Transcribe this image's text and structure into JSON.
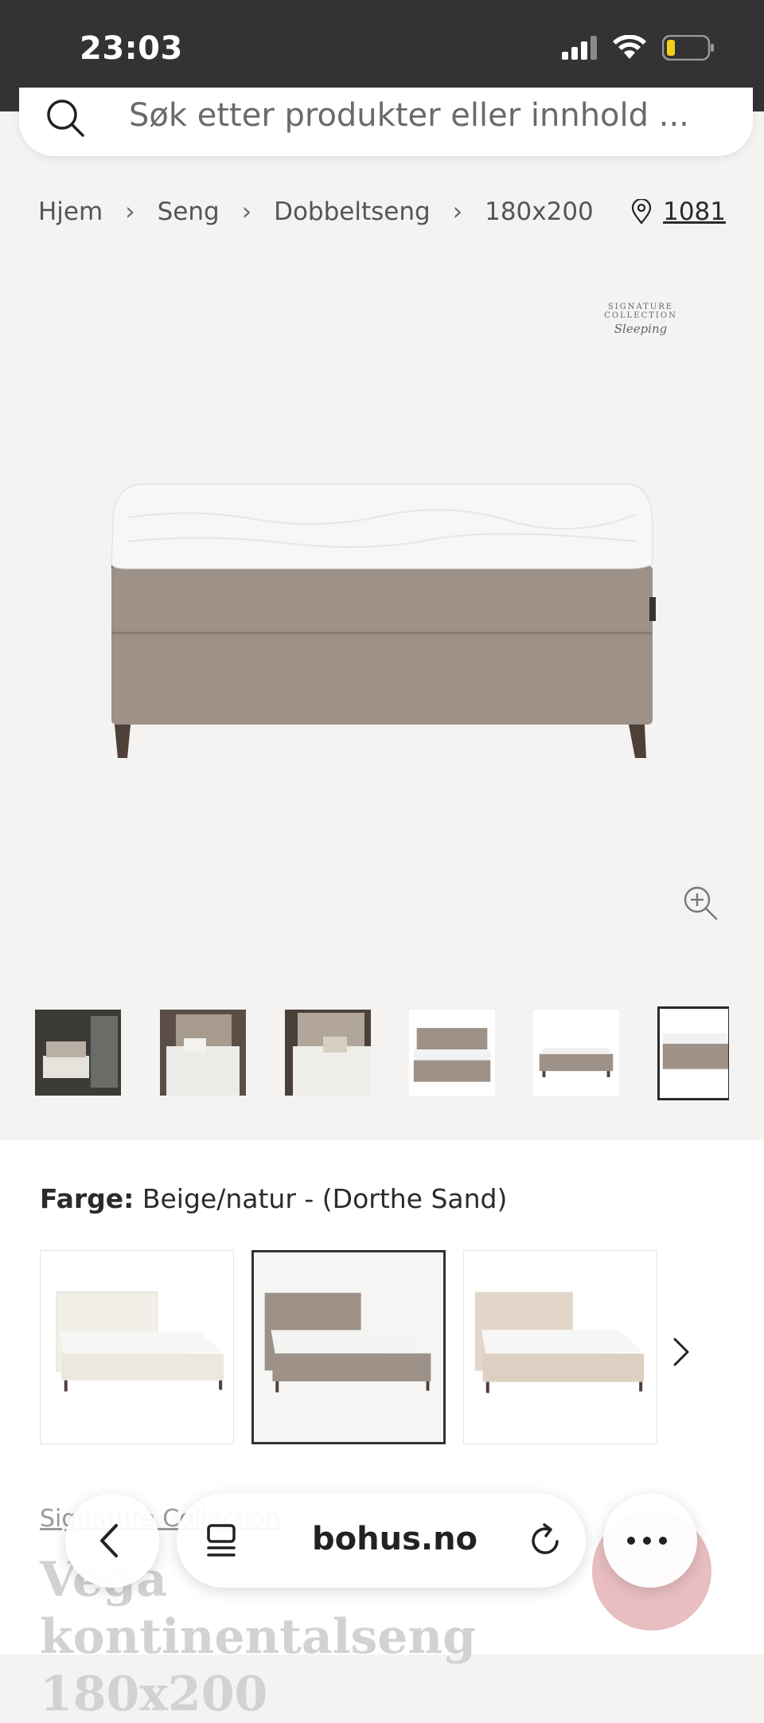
{
  "status": {
    "time": "23:03"
  },
  "search": {
    "placeholder": "Søk etter produkter eller innhold ..."
  },
  "breadcrumb": [
    "Hjem",
    "Seng",
    "Dobbeltseng",
    "180x200"
  ],
  "location": {
    "code": "1081"
  },
  "brand": {
    "line1": "SIGNATURE COLLECTION",
    "line2": "Sleeping"
  },
  "colors": {
    "accent_dark": "#333336",
    "bed_fabric": "#9b8f86",
    "mattress": "#f4f4f4",
    "fab": "#e6b7ba"
  },
  "color_picker": {
    "label": "Farge:",
    "value": "Beige/natur - (Dorthe Sand)"
  },
  "product": {
    "collection": "Signature Collection",
    "title_line1": "Vega kontinentalseng",
    "title_line2": "180x200"
  },
  "browser": {
    "domain": "bohus.no"
  },
  "icons": {
    "search": "search-icon",
    "pin": "location-pin-icon",
    "zoom": "zoom-in-icon",
    "back": "chevron-left-icon",
    "tabs": "tabs-icon",
    "reload": "reload-icon",
    "more": "more-icon",
    "next": "chevron-right-icon"
  }
}
